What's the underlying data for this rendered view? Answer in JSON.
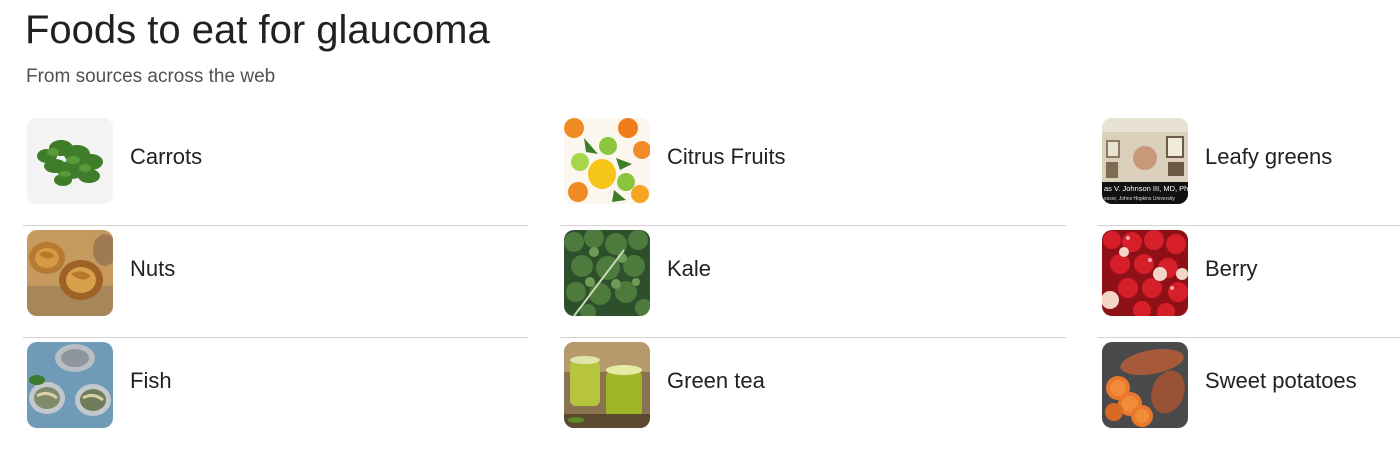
{
  "header": {
    "title": "Foods to eat for glaucoma",
    "subtitle": "From sources across the web"
  },
  "foods": [
    {
      "label": "Carrots",
      "image": "carrot-greens-image"
    },
    {
      "label": "Citrus Fruits",
      "image": "citrus-fruits-image"
    },
    {
      "label": "Leafy greens",
      "image": "doctor-video-thumbnail"
    },
    {
      "label": "Nuts",
      "image": "walnuts-image"
    },
    {
      "label": "Kale",
      "image": "kale-image"
    },
    {
      "label": "Berry",
      "image": "cherries-image"
    },
    {
      "label": "Fish",
      "image": "canned-fish-image"
    },
    {
      "label": "Green tea",
      "image": "green-tea-image"
    },
    {
      "label": "Sweet potatoes",
      "image": "sweet-potatoes-image"
    }
  ],
  "video_overlay": {
    "name_line": "as V. Johnson III, MD, PhD",
    "org_line": "essor, Johns Hopkins University"
  }
}
